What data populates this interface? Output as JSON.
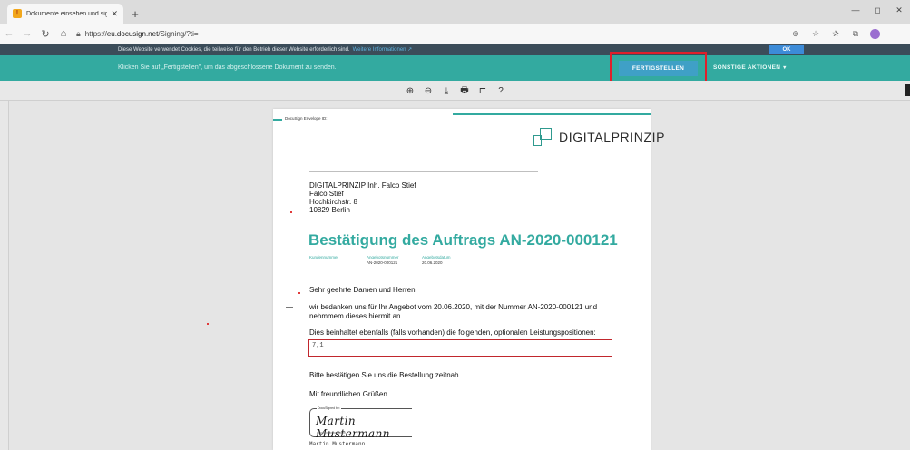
{
  "browser": {
    "tab_title": "Dokumente einsehen und signie",
    "favicon_glyph": "!",
    "url_prefix": "https://",
    "url_host": "eu.docusign.net",
    "url_path": "/Signing/?ti=",
    "new_tab": "+",
    "window_controls": {
      "minimize": "—",
      "maximize": "◻",
      "close": "✕"
    }
  },
  "cookie_bar": {
    "text": "Diese Website verwendet Cookies, die teilweise für den Betrieb dieser Website erforderlich sind.",
    "more_link": "Weitere Informationen ↗",
    "ok_label": "OK"
  },
  "action_bar": {
    "instruction": "Klicken Sie auf „Fertigstellen\", um das abgeschlossene Dokument zu senden.",
    "finish_label": "FERTIGSTELLEN",
    "other_actions_label": "SONSTIGE AKTIONEN",
    "other_actions_chevron": "▾"
  },
  "pdf_toolbar": {
    "zoom_in": "⊕",
    "zoom_out": "⊖",
    "download": "⤓",
    "print": "🖶",
    "comment": "⊏",
    "help": "?"
  },
  "document": {
    "envelope_label": "DocuSign Envelope ID:",
    "logo_text": "DIGITALPRINZIP",
    "address": [
      "DIGITALPRINZIP Inh. Falco Stief",
      "Falco Stief",
      "Hochkirchstr. 8",
      "10829 Berlin"
    ],
    "title": "Bestätigung des Auftrags AN-2020-000121",
    "meta": [
      {
        "label": "Kundennummer",
        "value": ""
      },
      {
        "label": "Angebotsnummer",
        "value": "AN-2020-000121"
      },
      {
        "label": "Angebotsdatum",
        "value": "20.06.2020"
      }
    ],
    "greeting": "Sehr geehrte Damen und Herren,",
    "body": "wir bedanken uns für Ihr Angebot vom 20.06.2020, mit der Nummer AN-2020-000121 und nehmmem dieses hiermit an.",
    "includes": "Dies beinhaltet ebenfalls (falls vorhanden) die folgenden, optionalen Leistungspositionen:",
    "positions_value": "7,1",
    "confirm": "Bitte bestätigen Sie uns die Bestellung zeitnah.",
    "regards": "Mit freundlichen Grüßen",
    "signature": {
      "label": "DocuSigned by:",
      "script": "Martin Mustermann",
      "id": "XXXXXXXXXXXXXXXX",
      "printed_name": "Martin Mustermann"
    }
  },
  "colors": {
    "docusign_teal": "#33aaa0",
    "finish_button": "#3fa0c6",
    "highlight_red": "#e0202b",
    "cookie_bar": "#3b4c59"
  }
}
